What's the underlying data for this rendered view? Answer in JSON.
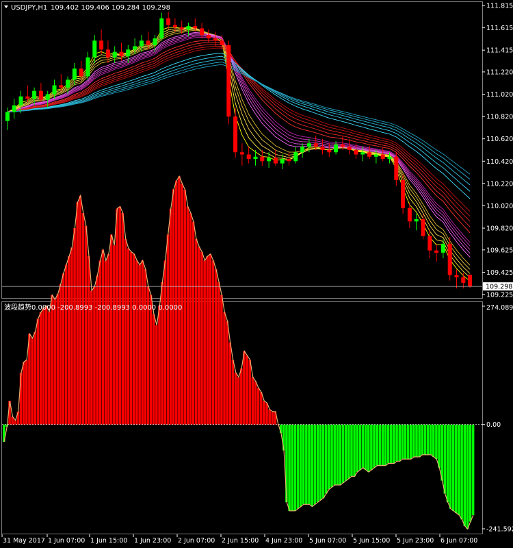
{
  "chart_data": [
    {
      "type": "candlestick",
      "title": "USDJPY,H1",
      "ohlc_readout": "109.402 109.406 109.284 109.298",
      "current_price": "109.298",
      "ylim": [
        109.225,
        111.815
      ],
      "y_ticks": [
        "111.815",
        "111.615",
        "111.415",
        "111.220",
        "111.020",
        "110.820",
        "110.620",
        "110.420",
        "110.220",
        "110.020",
        "109.820",
        "109.625",
        "109.425",
        "109.225"
      ],
      "candles": [
        [
          110.78,
          110.9,
          110.7,
          110.86
        ],
        [
          110.86,
          110.98,
          110.8,
          110.92
        ],
        [
          110.92,
          111.05,
          110.85,
          111.0
        ],
        [
          111.0,
          111.1,
          110.95,
          110.98
        ],
        [
          110.98,
          111.08,
          110.92,
          111.05
        ],
        [
          111.05,
          111.12,
          110.95,
          110.97
        ],
        [
          110.97,
          111.05,
          110.9,
          111.02
        ],
        [
          111.02,
          111.15,
          110.98,
          111.1
        ],
        [
          111.1,
          111.2,
          111.05,
          111.08
        ],
        [
          111.08,
          111.18,
          111.02,
          111.15
        ],
        [
          111.15,
          111.3,
          111.1,
          111.25
        ],
        [
          111.25,
          111.32,
          111.15,
          111.18
        ],
        [
          111.18,
          111.4,
          111.15,
          111.35
        ],
        [
          111.35,
          111.55,
          111.3,
          111.5
        ],
        [
          111.5,
          111.6,
          111.38,
          111.42
        ],
        [
          111.42,
          111.5,
          111.3,
          111.35
        ],
        [
          111.35,
          111.45,
          111.3,
          111.4
        ],
        [
          111.4,
          111.48,
          111.32,
          111.36
        ],
        [
          111.36,
          111.46,
          111.3,
          111.42
        ],
        [
          111.42,
          111.52,
          111.38,
          111.45
        ],
        [
          111.45,
          111.55,
          111.4,
          111.5
        ],
        [
          111.5,
          111.58,
          111.42,
          111.46
        ],
        [
          111.46,
          111.55,
          111.4,
          111.52
        ],
        [
          111.52,
          111.75,
          111.5,
          111.7
        ],
        [
          111.7,
          111.76,
          111.6,
          111.64
        ],
        [
          111.64,
          111.7,
          111.58,
          111.62
        ],
        [
          111.62,
          111.68,
          111.56,
          111.6
        ],
        [
          111.6,
          111.66,
          111.54,
          111.63
        ],
        [
          111.63,
          111.7,
          111.58,
          111.61
        ],
        [
          111.61,
          111.66,
          111.52,
          111.55
        ],
        [
          111.55,
          111.6,
          111.48,
          111.52
        ],
        [
          111.52,
          111.58,
          111.45,
          111.5
        ],
        [
          111.5,
          111.55,
          111.42,
          111.46
        ],
        [
          111.46,
          111.5,
          110.75,
          110.82
        ],
        [
          110.82,
          110.9,
          110.45,
          110.5
        ],
        [
          110.5,
          110.58,
          110.38,
          110.48
        ],
        [
          110.48,
          110.55,
          110.4,
          110.44
        ],
        [
          110.44,
          110.52,
          110.38,
          110.46
        ],
        [
          110.46,
          110.52,
          110.38,
          110.42
        ],
        [
          110.42,
          110.5,
          110.36,
          110.45
        ],
        [
          110.45,
          110.52,
          110.38,
          110.4
        ],
        [
          110.4,
          110.48,
          110.35,
          110.44
        ],
        [
          110.44,
          110.5,
          110.38,
          110.42
        ],
        [
          110.42,
          110.55,
          110.4,
          110.5
        ],
        [
          110.5,
          110.58,
          110.45,
          110.55
        ],
        [
          110.55,
          110.62,
          110.5,
          110.58
        ],
        [
          110.58,
          110.65,
          110.52,
          110.55
        ],
        [
          110.55,
          110.62,
          110.48,
          110.52
        ],
        [
          110.52,
          110.58,
          110.46,
          110.5
        ],
        [
          110.5,
          110.6,
          110.48,
          110.57
        ],
        [
          110.57,
          110.65,
          110.52,
          110.55
        ],
        [
          110.55,
          110.62,
          110.48,
          110.52
        ],
        [
          110.52,
          110.58,
          110.44,
          110.48
        ],
        [
          110.48,
          110.55,
          110.42,
          110.5
        ],
        [
          110.5,
          110.56,
          110.44,
          110.46
        ],
        [
          110.46,
          110.52,
          110.4,
          110.48
        ],
        [
          110.48,
          110.54,
          110.42,
          110.44
        ],
        [
          110.44,
          110.5,
          110.4,
          110.46
        ],
        [
          110.46,
          110.5,
          110.2,
          110.25
        ],
        [
          110.25,
          110.3,
          109.95,
          110.0
        ],
        [
          110.0,
          110.05,
          109.82,
          109.88
        ],
        [
          109.88,
          109.95,
          109.8,
          109.9
        ],
        [
          109.9,
          109.95,
          109.72,
          109.75
        ],
        [
          109.75,
          109.8,
          109.55,
          109.62
        ],
        [
          109.62,
          109.68,
          109.52,
          109.6
        ],
        [
          109.6,
          109.72,
          109.55,
          109.68
        ],
        [
          109.68,
          109.74,
          109.35,
          109.4
        ],
        [
          109.4,
          109.45,
          109.28,
          109.38
        ],
        [
          109.38,
          109.42,
          109.28,
          109.33
        ],
        [
          109.402,
          109.406,
          109.284,
          109.298
        ]
      ]
    },
    {
      "type": "histogram",
      "title": "波段趋势",
      "readout": "0.0000 -200.8993 -200.8993 0.0000 0.0000",
      "ylim": [
        -241.5926,
        274.0895
      ],
      "y_ticks": [
        "274.0895",
        "0.00",
        "-241.5926"
      ],
      "values": [
        -40,
        -5,
        55,
        18,
        10,
        30,
        120,
        145,
        150,
        210,
        200,
        215,
        245,
        260,
        270,
        275,
        262,
        300,
        290,
        302,
        325,
        350,
        370,
        390,
        410,
        455,
        515,
        530,
        490,
        460,
        390,
        310,
        320,
        345,
        380,
        405,
        380,
        395,
        440,
        415,
        500,
        505,
        490,
        430,
        408,
        400,
        395,
        380,
        370,
        380,
        360,
        320,
        300,
        255,
        230,
        275,
        330,
        380,
        440,
        500,
        545,
        565,
        575,
        558,
        544,
        505,
        490,
        470,
        430,
        412,
        400,
        380,
        390,
        395,
        380,
        360,
        330,
        300,
        260,
        240,
        190,
        150,
        120,
        110,
        130,
        170,
        160,
        150,
        110,
        100,
        85,
        75,
        55,
        50,
        35,
        30,
        30,
        0,
        -20,
        -60,
        -180,
        -200,
        -200,
        -200,
        -195,
        -190,
        -185,
        -185,
        -185,
        -190,
        -185,
        -180,
        -175,
        -170,
        -160,
        -150,
        -145,
        -140,
        -140,
        -140,
        -135,
        -130,
        -125,
        -120,
        -120,
        -110,
        -105,
        -100,
        -105,
        -110,
        -105,
        -100,
        -95,
        -95,
        -95,
        -95,
        -90,
        -90,
        -90,
        -85,
        -85,
        -80,
        -80,
        -80,
        -80,
        -75,
        -75,
        -75,
        -70,
        -70,
        -70,
        -70,
        -75,
        -80,
        -100,
        -130,
        -160,
        -180,
        -195,
        -200,
        -205,
        -210,
        -220,
        -235,
        -242,
        -225,
        -210
      ]
    }
  ],
  "x_labels": [
    "31 May 2017",
    "1 Jun 07:00",
    "1 Jun 15:00",
    "1 Jun 23:00",
    "2 Jun 07:00",
    "2 Jun 15:00",
    "4 Jun 23:00",
    "5 Jun 07:00",
    "5 Jun 15:00",
    "5 Jun 23:00",
    "6 Jun 07:00"
  ],
  "colors": {
    "bull": "#00ff00",
    "bear": "#ff0000",
    "hist_pos": "#ff0000",
    "hist_neg": "#00ff00",
    "hist_outline": "#e8b070",
    "grid": "#7f7f7f",
    "price_line": "#c0c0c0"
  }
}
